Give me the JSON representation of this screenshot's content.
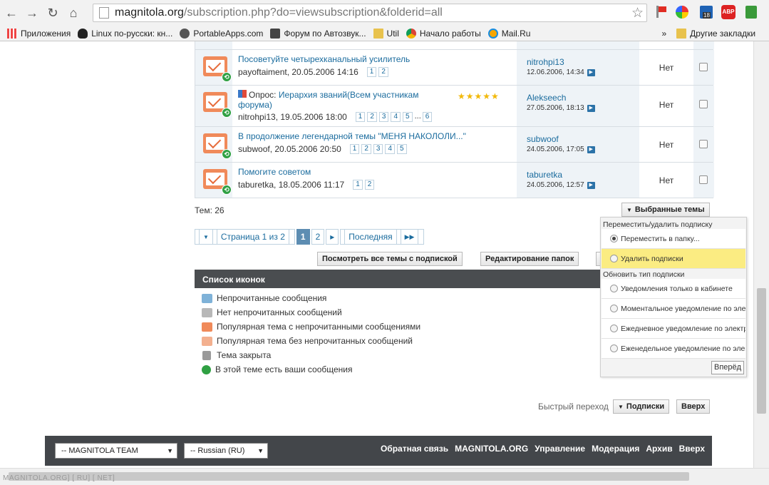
{
  "browser": {
    "url_host": "magnitola.org",
    "url_path": "/subscription.php?do=viewsubscription&folderid=all",
    "bookmarks": [
      {
        "label": "Приложения"
      },
      {
        "label": "Linux по-русски: кн..."
      },
      {
        "label": "PortableApps.com"
      },
      {
        "label": "Форум по Автозвук..."
      },
      {
        "label": "Util"
      },
      {
        "label": "Начало работы"
      },
      {
        "label": "Mail.Ru"
      }
    ],
    "overflow": "»",
    "other_bookmarks": "Другие закладки",
    "abp_badge": "ABP",
    "ext_badge": "18"
  },
  "threads": [
    {
      "title": "Посоветуйте четырехканальный усилитель",
      "author_date": "payoftaiment, 20.05.2006 14:16",
      "pages": [
        "1",
        "2"
      ],
      "last_user": "nitrohpi13",
      "last_date": "12.06.2006, 14:34",
      "notify": "Нет"
    },
    {
      "poll_prefix": "Опрос:",
      "title": "Иерархия званий(Всем участникам форума)",
      "author_date": "nitrohpi13, 19.05.2006 18:00",
      "pages": [
        "1",
        "2",
        "3",
        "4",
        "5",
        "...",
        "6"
      ],
      "stars": "★★★★★",
      "last_user": "Alekseech",
      "last_date": "27.05.2006, 18:13",
      "notify": "Нет"
    },
    {
      "title": "В продолжение легендарной темы \"МЕНЯ НАКОЛОЛИ...\"",
      "author_date": "subwoof, 20.05.2006 20:50",
      "pages": [
        "1",
        "2",
        "3",
        "4",
        "5"
      ],
      "last_user": "subwoof",
      "last_date": "24.05.2006, 17:05",
      "notify": "Нет"
    },
    {
      "title": "Помогите советом",
      "author_date": "taburetka, 18.05.2006 11:17",
      "pages": [
        "1",
        "2"
      ],
      "last_user": "taburetka",
      "last_date": "24.05.2006, 12:57",
      "notify": "Нет"
    }
  ],
  "topics_count": "Тем: 26",
  "selected_btn": "Выбранные темы",
  "pager": {
    "label": "Страница 1 из 2",
    "current": "1",
    "next_page": "2",
    "next_arrow": "▸",
    "last": "Последняя"
  },
  "buttons": {
    "view_all": "Посмотреть все темы с подпиской",
    "edit_folders": "Редактирование папок"
  },
  "iconlist": {
    "title": "Список иконок",
    "items": [
      {
        "label": "Непрочитанные сообщения",
        "color": "#7fb2d8"
      },
      {
        "label": "Нет непрочитанных сообщений",
        "color": "#b8b8b8"
      },
      {
        "label": "Популярная тема с непрочитанными сообщениями",
        "color": "#f08a5a"
      },
      {
        "label": "Популярная тема без непрочитанных сообщений",
        "color": "#f3b08f"
      },
      {
        "label": "Тема закрыта",
        "color": "#9a9a9a"
      },
      {
        "label": "В этой теме есть ваши сообщения",
        "color": "#2fa043"
      }
    ]
  },
  "dropdown": {
    "section1": "Переместить/удалить подписку",
    "move": "Переместить в папку...",
    "delete": "Удалить подписки",
    "section2": "Обновить тип подписки",
    "opt_cabinet": "Уведомления только в кабинете",
    "opt_instant": "Моментальное уведомление по элек",
    "opt_daily": "Ежедневное уведомление по электр",
    "opt_weekly": "Еженедельное уведомление по элек",
    "go": "Вперёд"
  },
  "quicknav": {
    "label": "Быстрый переход",
    "select": "Подписки",
    "top": "Вверх"
  },
  "footer": {
    "style_select": "-- MAGNITOLA TEAM",
    "lang_select": "-- Russian (RU)",
    "links": [
      "Обратная связь",
      "MAGNITOLA.ORG",
      "Управление",
      "Модерация",
      "Архив",
      "Вверх"
    ]
  },
  "status_text": "MAGNITOLA.ORG] [ RU] [ NET]"
}
